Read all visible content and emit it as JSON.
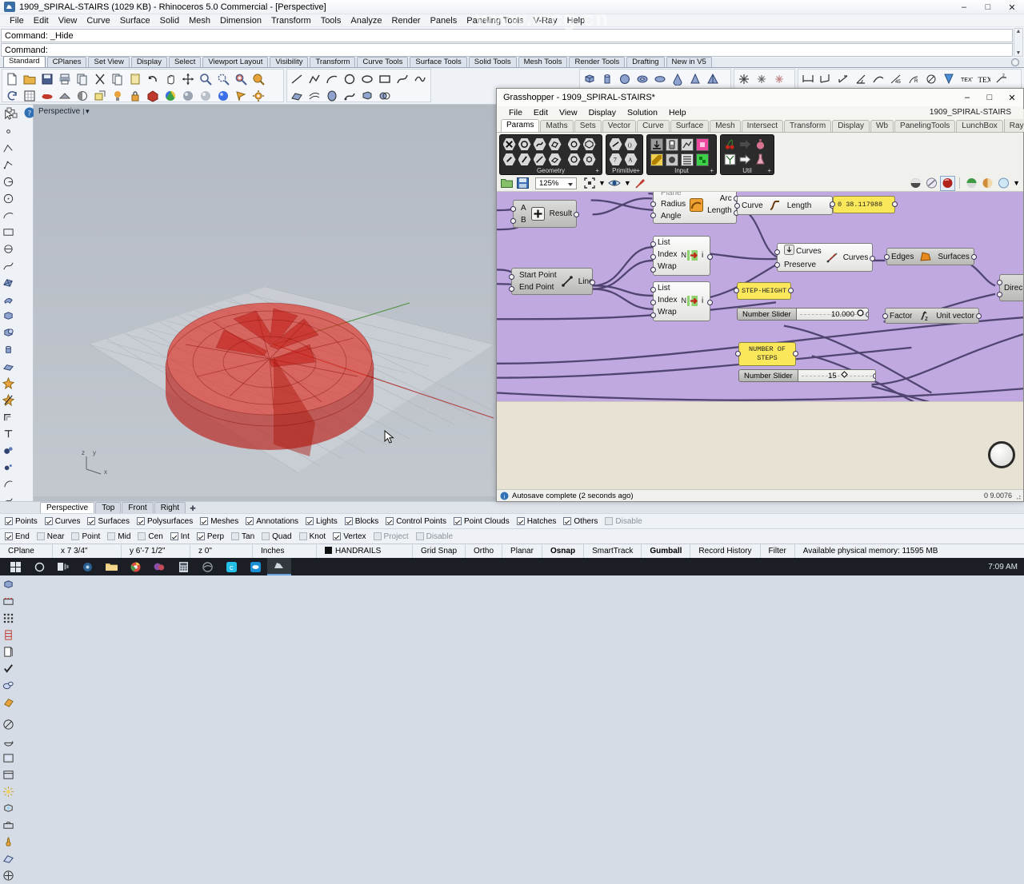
{
  "rhino": {
    "title": "1909_SPIRAL-STAIRS (1029 KB) - Rhinoceros 5.0 Commercial - [Perspective]",
    "menu": [
      "File",
      "Edit",
      "View",
      "Curve",
      "Surface",
      "Solid",
      "Mesh",
      "Dimension",
      "Transform",
      "Tools",
      "Analyze",
      "Render",
      "Panels",
      "Paneling Tools",
      "V-Ray",
      "Help"
    ],
    "command_history": "Command: _Hide",
    "command_prompt": "Command:",
    "toolbar_tabs": [
      "Standard",
      "CPlanes",
      "Set View",
      "Display",
      "Select",
      "Viewport Layout",
      "Visibility",
      "Transform",
      "Curve Tools",
      "Surface Tools",
      "Solid Tools",
      "Mesh Tools",
      "Render Tools",
      "Drafting",
      "New in V5"
    ],
    "active_toolbar_tab": "Standard",
    "viewport_label": "Perspective",
    "viewport_tabs": [
      "Perspective",
      "Top",
      "Front",
      "Right"
    ],
    "active_viewport_tab": "Perspective",
    "filter_row1": [
      {
        "label": "Points",
        "checked": true
      },
      {
        "label": "Curves",
        "checked": true
      },
      {
        "label": "Surfaces",
        "checked": true
      },
      {
        "label": "Polysurfaces",
        "checked": true
      },
      {
        "label": "Meshes",
        "checked": true
      },
      {
        "label": "Annotations",
        "checked": true
      },
      {
        "label": "Lights",
        "checked": true
      },
      {
        "label": "Blocks",
        "checked": true
      },
      {
        "label": "Control Points",
        "checked": true
      },
      {
        "label": "Point Clouds",
        "checked": true
      },
      {
        "label": "Hatches",
        "checked": true
      },
      {
        "label": "Others",
        "checked": true
      },
      {
        "label": "Disable",
        "checked": false
      }
    ],
    "osnap_row": [
      {
        "label": "End",
        "checked": true
      },
      {
        "label": "Near",
        "checked": false
      },
      {
        "label": "Point",
        "checked": false
      },
      {
        "label": "Mid",
        "checked": false
      },
      {
        "label": "Cen",
        "checked": false
      },
      {
        "label": "Int",
        "checked": true
      },
      {
        "label": "Perp",
        "checked": true
      },
      {
        "label": "Tan",
        "checked": false
      },
      {
        "label": "Quad",
        "checked": false
      },
      {
        "label": "Knot",
        "checked": false
      },
      {
        "label": "Vertex",
        "checked": true
      },
      {
        "label": "Project",
        "checked": false
      },
      {
        "label": "Disable",
        "checked": false
      }
    ],
    "status": {
      "cplane": "CPlane",
      "x": "x 7 3/4\"",
      "y": "y 6'-7 1/2\"",
      "z": "z 0\"",
      "units": "Inches",
      "layer": "HANDRAILS",
      "grid_snap": "Grid Snap",
      "ortho": "Ortho",
      "planar": "Planar",
      "osnap": "Osnap",
      "smarttrack": "SmartTrack",
      "gumball": "Gumball",
      "record_history": "Record History",
      "filter": "Filter",
      "memory": "Available physical memory: 11595 MB"
    }
  },
  "taskbar": {
    "clock": "7:09 AM"
  },
  "watermarks": [
    "www.rrcg.cn"
  ],
  "grasshopper": {
    "title": "Grasshopper - 1909_SPIRAL-STAIRS*",
    "menu": [
      "File",
      "Edit",
      "View",
      "Display",
      "Solution",
      "Help"
    ],
    "document_name": "1909_SPIRAL-STAIRS",
    "tabs": [
      "Params",
      "Maths",
      "Sets",
      "Vector",
      "Curve",
      "Surface",
      "Mesh",
      "Intersect",
      "Transform",
      "Display",
      "Wb",
      "PanelingTools",
      "LunchBox",
      "V-Ray"
    ],
    "active_tab": "Params",
    "ribbon_groups": [
      {
        "label": "Geometry"
      },
      {
        "label": "Primitive"
      },
      {
        "label": "Input"
      },
      {
        "label": "Util"
      }
    ],
    "canvas_toolbar": {
      "zoom": "125%"
    },
    "status": {
      "message": "Autosave complete (2 seconds ago)",
      "right": "0 9.0076"
    },
    "components": [
      {
        "name": "addition",
        "inputs": [
          "A",
          "B"
        ],
        "outputs": [
          "Result"
        ],
        "icon": "plus-icon"
      },
      {
        "name": "arc",
        "inputs": [
          "Plane",
          "Radius",
          "Angle"
        ],
        "outputs": [
          "Arc",
          "Length"
        ],
        "icon": "arc-icon"
      },
      {
        "name": "curve-length",
        "inputs": [
          "Curve"
        ],
        "outputs": [
          "Length"
        ],
        "icon": "curve-length-icon"
      },
      {
        "name": "line",
        "inputs": [
          "Start Point",
          "End Point"
        ],
        "outputs": [
          "Line"
        ],
        "icon": "line-icon"
      },
      {
        "name": "list-item-1",
        "inputs": [
          "List",
          "Index",
          "Wrap"
        ],
        "outputs": [
          "i"
        ],
        "icon": "list-item-icon"
      },
      {
        "name": "list-item-2",
        "inputs": [
          "List",
          "Index",
          "Wrap"
        ],
        "outputs": [
          "i"
        ],
        "icon": "list-item-icon"
      },
      {
        "name": "join-curves",
        "inputs": [
          "Curves",
          "Preserve"
        ],
        "outputs": [
          "Curves"
        ],
        "icon": "join-curves-icon"
      },
      {
        "name": "boundary-surfaces",
        "inputs": [
          "Edges"
        ],
        "outputs": [
          "Surfaces"
        ],
        "icon": "boundary-icon"
      },
      {
        "name": "unit-z",
        "inputs": [
          "Factor"
        ],
        "outputs": [
          "Unit vector"
        ],
        "icon": "unitz-icon"
      },
      {
        "name": "direction",
        "inputs": [
          "Direc"
        ],
        "outputs": [],
        "icon": "direction-icon"
      }
    ],
    "panels": [
      {
        "name": "length-output-panel",
        "text": "0  38.117988"
      },
      {
        "name": "step-height-label",
        "text": "STEP-HEIGHT"
      },
      {
        "name": "number-of-steps-label",
        "text": "NUMBER OF\nSTEPS"
      }
    ],
    "sliders": [
      {
        "name": "step-height-slider",
        "label": "Number Slider",
        "value": "10.000"
      },
      {
        "name": "number-of-steps-slider",
        "label": "Number Slider",
        "value": "15"
      }
    ]
  }
}
